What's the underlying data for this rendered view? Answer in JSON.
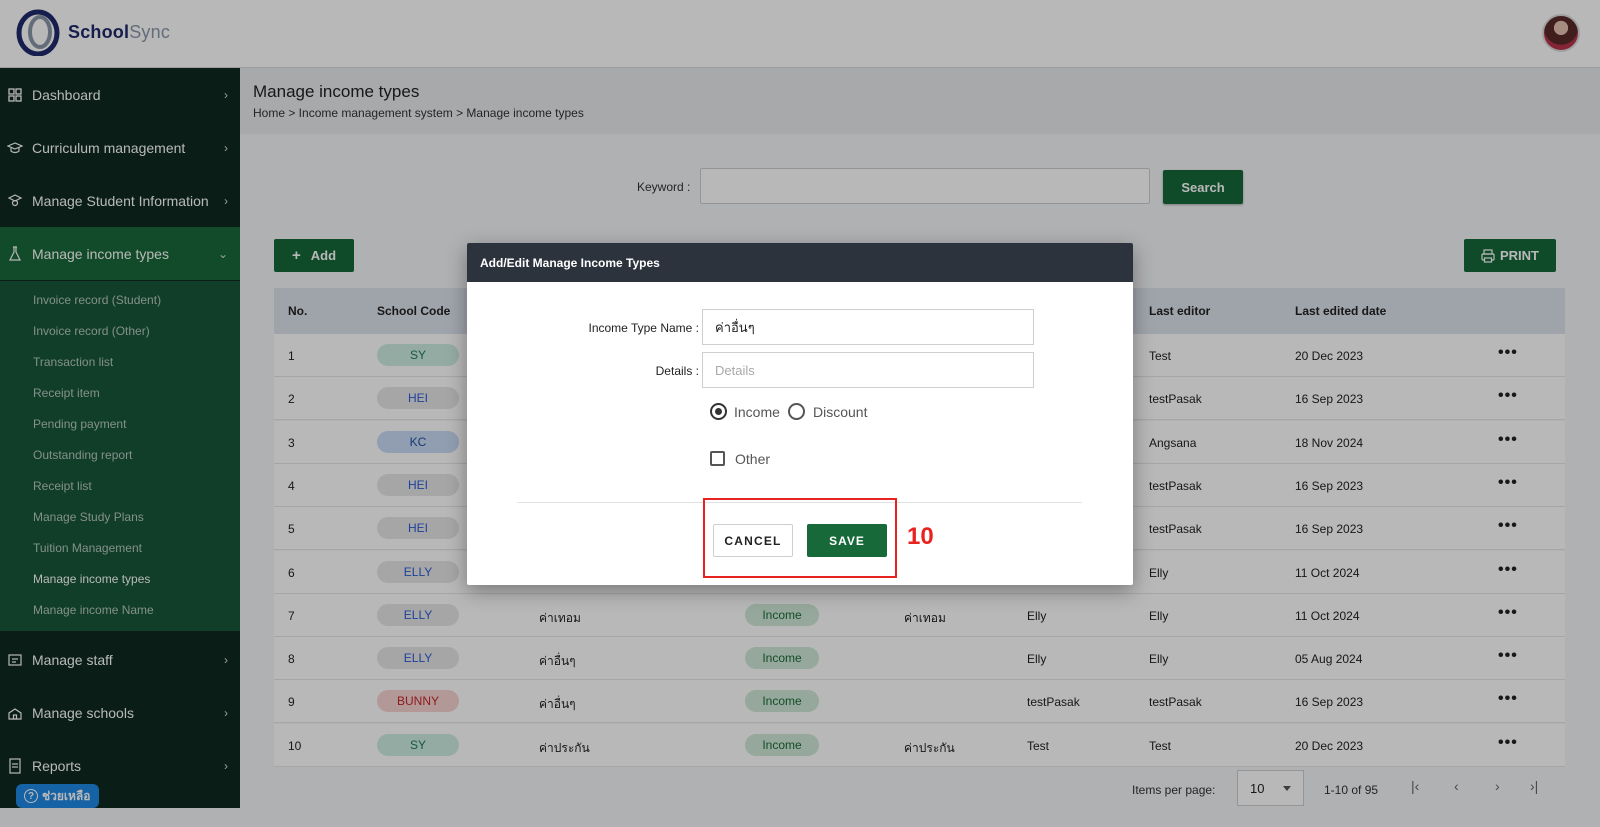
{
  "app": {
    "name_part1": "School",
    "name_part2": "Sync"
  },
  "sidebar": {
    "items": [
      {
        "label": "Dashboard",
        "icon": "grid-icon"
      },
      {
        "label": "Curriculum management",
        "icon": "graduation-cap-icon"
      },
      {
        "label": "Manage Student Information",
        "icon": "student-icon"
      },
      {
        "label": "Manage income types",
        "icon": "flask-icon",
        "expanded": true
      },
      {
        "label": "Manage staff",
        "icon": "id-card-icon"
      },
      {
        "label": "Manage schools",
        "icon": "school-icon"
      },
      {
        "label": "Reports",
        "icon": "report-icon"
      }
    ],
    "submenu": [
      "Invoice record (Student)",
      "Invoice record (Other)",
      "Transaction list",
      "Receipt item",
      "Pending payment",
      "Outstanding report",
      "Receipt list",
      "Manage Study Plans",
      "Tuition Management",
      "Manage income types",
      "Manage income Name"
    ],
    "help_label": "ช่วยเหลือ"
  },
  "page": {
    "title": "Manage income types",
    "breadcrumb": "Home > Income management system > Manage income types"
  },
  "search": {
    "keyword_label": "Keyword :",
    "value": "",
    "button": "Search"
  },
  "toolbar": {
    "add_label": "Add",
    "print_label": "PRINT"
  },
  "table": {
    "headers": {
      "no": "No.",
      "school_code": "School Code",
      "last_editor": "Last editor",
      "last_edited_date": "Last edited date"
    },
    "rows": [
      {
        "no": "1",
        "code": "SY",
        "name": "",
        "type": "",
        "details": "",
        "creator": "",
        "editor": "Test",
        "date": "20 Dec 2023"
      },
      {
        "no": "2",
        "code": "HEI",
        "name": "",
        "type": "",
        "details": "",
        "creator": "",
        "editor": "testPasak",
        "date": "16 Sep 2023"
      },
      {
        "no": "3",
        "code": "KC",
        "name": "",
        "type": "",
        "details": "",
        "creator": "",
        "editor": "Angsana",
        "date": "18 Nov 2024"
      },
      {
        "no": "4",
        "code": "HEI",
        "name": "",
        "type": "",
        "details": "",
        "creator": "",
        "editor": "testPasak",
        "date": "16 Sep 2023"
      },
      {
        "no": "5",
        "code": "HEI",
        "name": "",
        "type": "",
        "details": "",
        "creator": "",
        "editor": "testPasak",
        "date": "16 Sep 2023"
      },
      {
        "no": "6",
        "code": "ELLY",
        "name": "",
        "type": "",
        "details": "",
        "creator": "",
        "editor": "Elly",
        "date": "11 Oct 2024"
      },
      {
        "no": "7",
        "code": "ELLY",
        "name": "ค่าเทอม",
        "type": "Income",
        "details": "ค่าเทอม",
        "creator": "Elly",
        "editor": "Elly",
        "date": "11 Oct 2024"
      },
      {
        "no": "8",
        "code": "ELLY",
        "name": "ค่าอื่นๆ",
        "type": "Income",
        "details": "",
        "creator": "Elly",
        "editor": "Elly",
        "date": "05 Aug 2024"
      },
      {
        "no": "9",
        "code": "BUNNY",
        "name": "ค่าอื่นๆ",
        "type": "Income",
        "details": "",
        "creator": "testPasak",
        "editor": "testPasak",
        "date": "16 Sep 2023"
      },
      {
        "no": "10",
        "code": "SY",
        "name": "ค่าประกัน",
        "type": "Income",
        "details": "ค่าประกัน",
        "creator": "Test",
        "editor": "Test",
        "date": "20 Dec 2023"
      }
    ],
    "row_action": "•••"
  },
  "badge_colors": {
    "SY": {
      "bg": "#cdeee2",
      "fg": "#1f7a5a"
    },
    "HEI": {
      "bg": "#e6e6e6",
      "fg": "#2a5bd7"
    },
    "KC": {
      "bg": "#c9dcf5",
      "fg": "#1f4f9e"
    },
    "ELLY": {
      "bg": "#e6e6e6",
      "fg": "#2a5bd7"
    },
    "BUNNY": {
      "bg": "#f8d3d3",
      "fg": "#c62828"
    }
  },
  "pagination": {
    "items_per_page_label": "Items per page:",
    "per_page": "10",
    "range": "1-10 of 95"
  },
  "modal": {
    "title": "Add/Edit Manage Income Types",
    "income_type_name_label": "Income Type Name :",
    "income_type_name_value": "ค่าอื่นๆ",
    "details_label": "Details :",
    "details_placeholder": "Details",
    "radio_income": "Income",
    "radio_discount": "Discount",
    "selected_type": "Income",
    "other_label": "Other",
    "other_checked": false,
    "cancel_label": "CANCEL",
    "save_label": "SAVE"
  },
  "annotation": {
    "step_number": "10"
  },
  "colors": {
    "primary_green": "#17693a",
    "sidebar_bg": "#0f2a21",
    "highlight_red": "#e8231f"
  }
}
